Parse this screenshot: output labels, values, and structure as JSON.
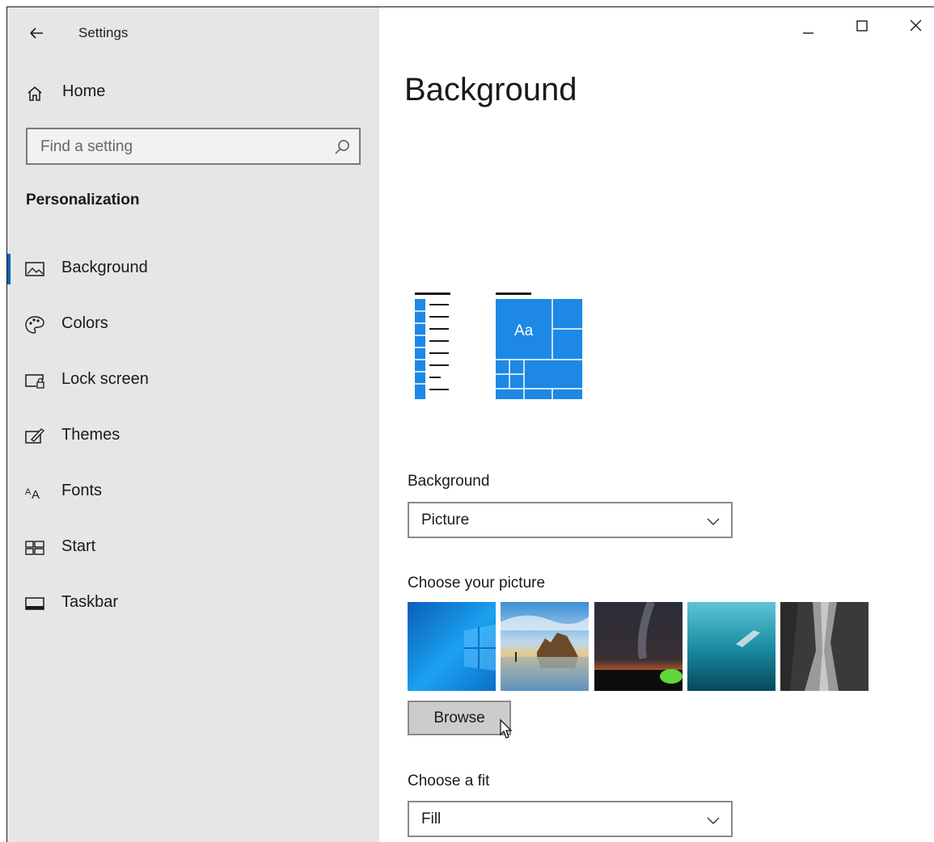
{
  "window": {
    "title": "Settings",
    "controls": [
      "minimize",
      "maximize",
      "close"
    ]
  },
  "sidebar": {
    "home_label": "Home",
    "search_placeholder": "Find a setting",
    "section_title": "Personalization",
    "items": [
      {
        "label": "Background",
        "icon": "picture-icon",
        "active": true
      },
      {
        "label": "Colors",
        "icon": "palette-icon",
        "active": false
      },
      {
        "label": "Lock screen",
        "icon": "lock-screen-icon",
        "active": false
      },
      {
        "label": "Themes",
        "icon": "themes-icon",
        "active": false
      },
      {
        "label": "Fonts",
        "icon": "fonts-icon",
        "active": false
      },
      {
        "label": "Start",
        "icon": "start-icon",
        "active": false
      },
      {
        "label": "Taskbar",
        "icon": "taskbar-icon",
        "active": false
      }
    ]
  },
  "main": {
    "page_title": "Background",
    "preview_text": "Aa",
    "background_label": "Background",
    "background_value": "Picture",
    "choose_picture_label": "Choose your picture",
    "browse_label": "Browse",
    "fit_label": "Choose a fit",
    "fit_value": "Fill"
  },
  "colors": {
    "accent": "#0063b1",
    "tile_blue": "#1e88e5",
    "sidebar_bg": "#e6e6e6"
  }
}
